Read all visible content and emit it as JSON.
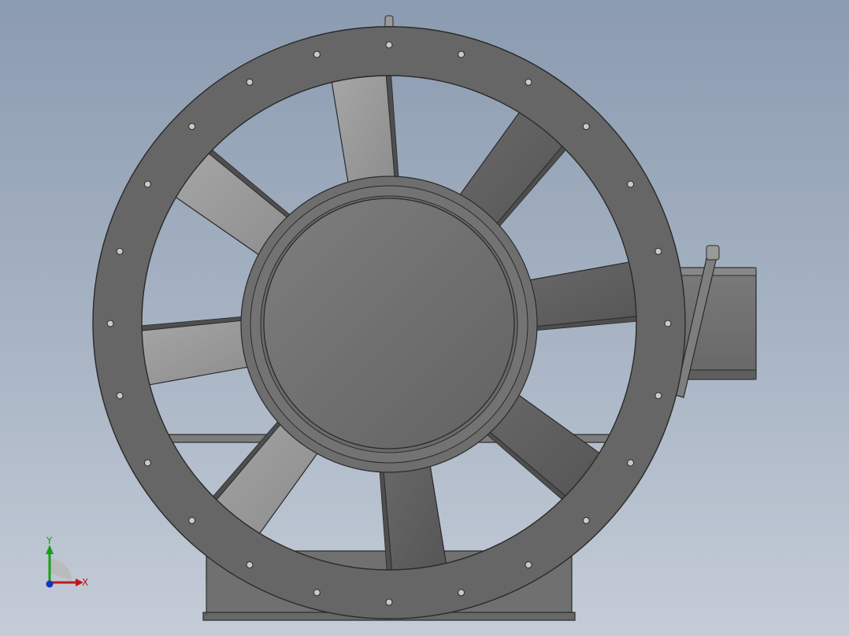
{
  "model": {
    "fan_blade_count": 8,
    "flange_bolt_hole_count": 24
  },
  "triad": {
    "x_label": "X",
    "y_label": "Y",
    "x_color": "#c01818",
    "y_color": "#14a014",
    "z_color": "#1830c0"
  },
  "colors": {
    "background_top": "#8b9bb0",
    "background_bottom": "#c4ccd7",
    "ring": "#656565",
    "hub": "#717171",
    "edge": "#2a2a2a"
  }
}
